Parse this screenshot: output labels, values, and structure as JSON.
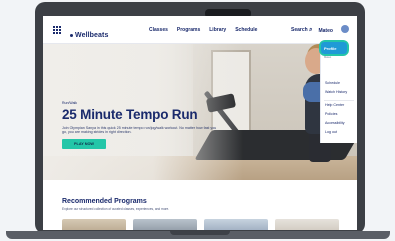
{
  "nav": {
    "logo_text": "Wellbeats",
    "logo_subtext": "WELLBEATS",
    "links": [
      "Classes",
      "Programs",
      "Library",
      "Schedule"
    ],
    "search_label": "Search",
    "user_label": "Mateo"
  },
  "hero": {
    "eyebrow": "Run/Walk",
    "title": "25 Minute Tempo Run",
    "description": "Join Olympian Sanya in this quick 25 minute tempo run/jog/walk workout. No matter how fast you go, you are making strides in right direction.",
    "cta_label": "PLAY NOW"
  },
  "menu": {
    "active_item": "Profile",
    "active_subtext": "Mateo",
    "items": [
      "Schedule",
      "Watch History",
      "Help Center",
      "Policies",
      "Accessibility",
      "Log out"
    ]
  },
  "recommended": {
    "title": "Recommended Programs",
    "subtitle": "Explore our structured collection of curated classes, experiences, and more."
  },
  "colors": {
    "brand": "#1a2a6c",
    "accent": "#24c6a8",
    "active_menu": "#1f9ad6"
  }
}
